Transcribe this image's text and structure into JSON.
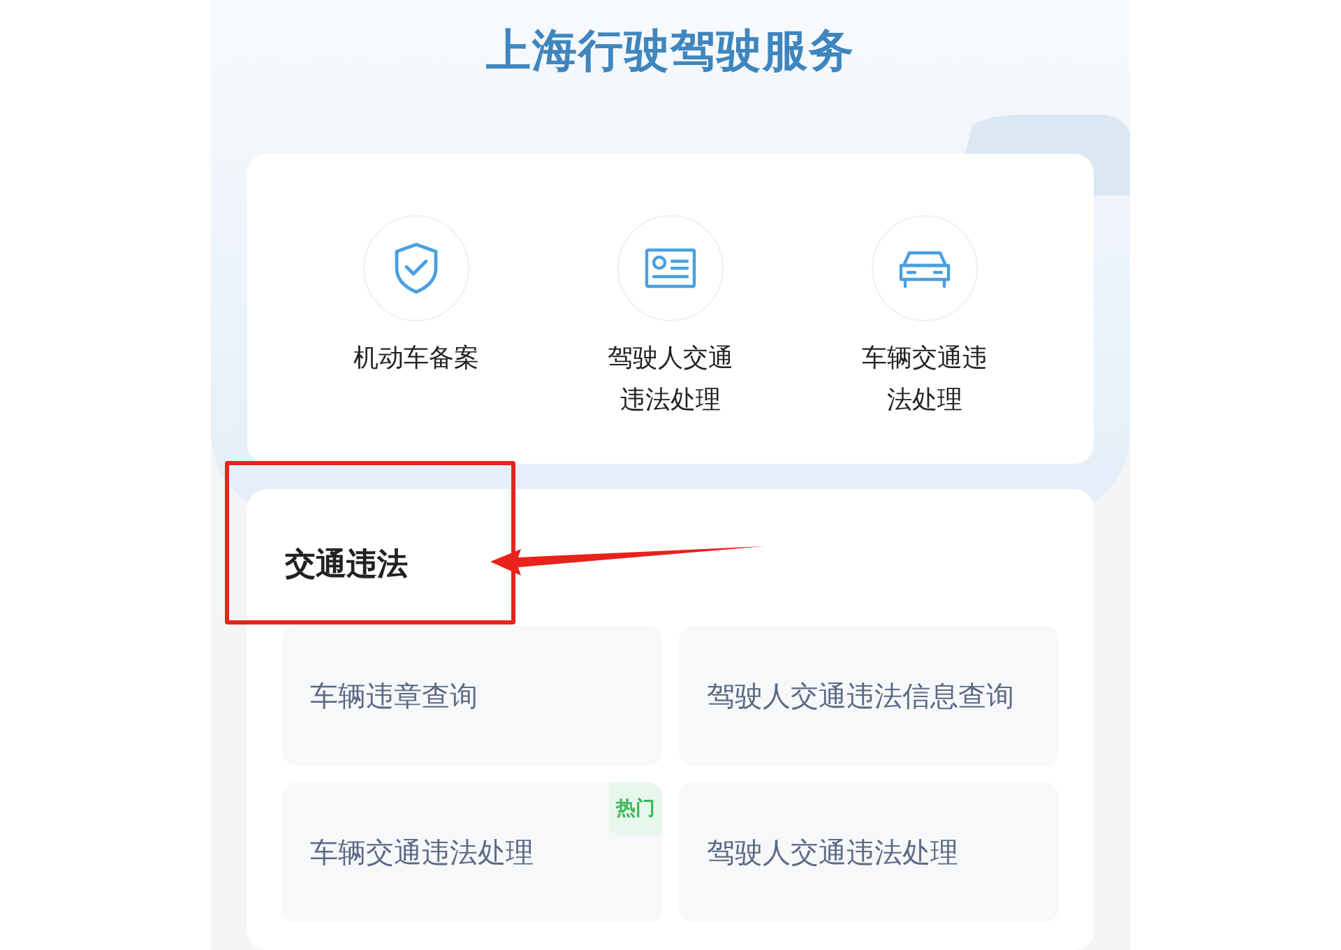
{
  "title": "上海行驶驾驶服务",
  "services": [
    {
      "kind": "shield",
      "label": "机动车备案"
    },
    {
      "kind": "id-card",
      "label": "驾驶人交通违法处理"
    },
    {
      "kind": "car",
      "label": "车辆交通违法处理"
    }
  ],
  "section": {
    "title": "交通违法",
    "items": [
      {
        "label": "车辆违章查询"
      },
      {
        "label": "驾驶人交通违法信息查询"
      },
      {
        "label": "车辆交通违法处理",
        "badge": "热门"
      },
      {
        "label": "驾驶人交通违法处理"
      }
    ]
  }
}
